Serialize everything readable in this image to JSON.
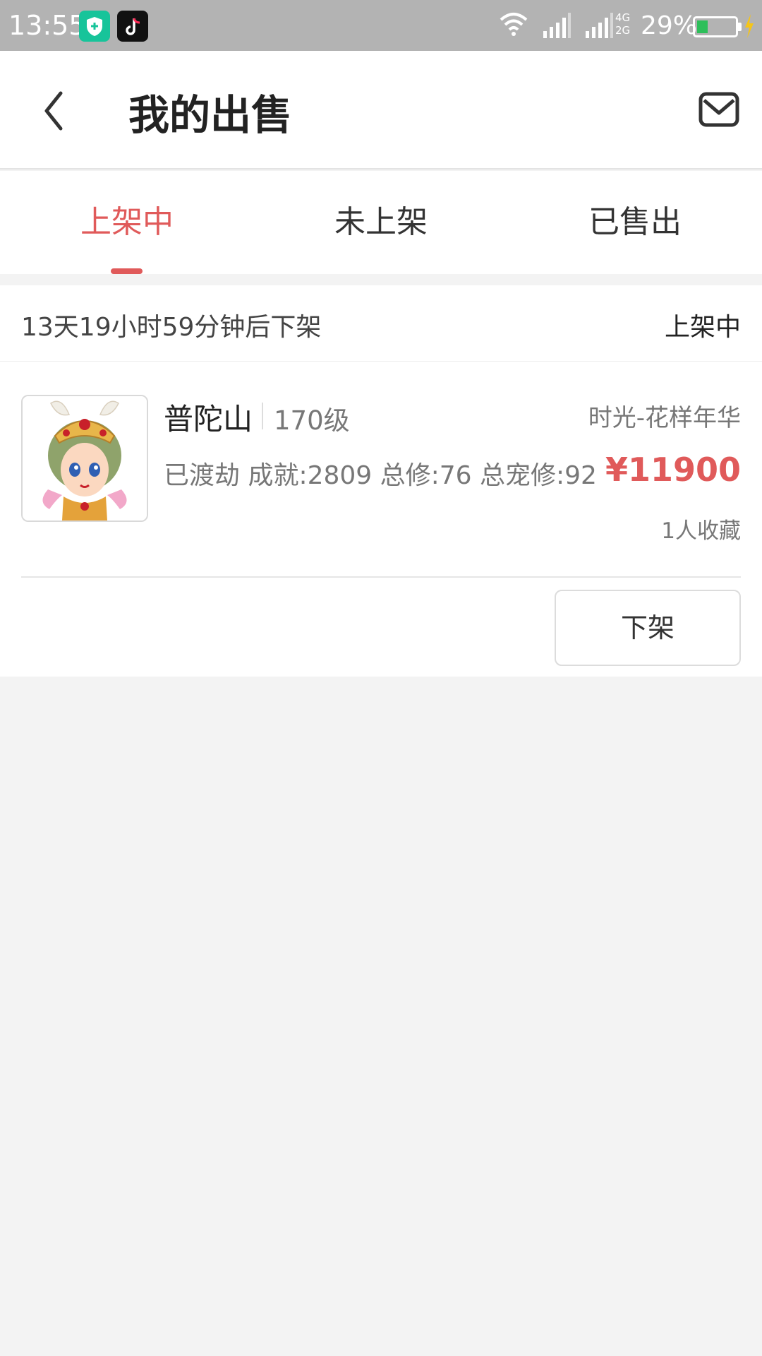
{
  "status_bar": {
    "time": "13:55",
    "network": "4G\n2G",
    "battery": "29%",
    "battery_level": 0.29,
    "icons": [
      "shield-app-icon",
      "tiktok-app-icon",
      "wifi-icon",
      "signal-icon",
      "signal-icon",
      "battery-icon",
      "charging-icon"
    ]
  },
  "header": {
    "back_icon": "chevron-left-icon",
    "title": "我的出售",
    "mail_icon": "mail-icon"
  },
  "tabs": [
    {
      "label": "上架中",
      "active": true
    },
    {
      "label": "未上架",
      "active": false
    },
    {
      "label": "已售出",
      "active": false
    }
  ],
  "listing": {
    "countdown": "13天19小时59分钟后下架",
    "status": "上架中",
    "name": "普陀山",
    "level": "170级",
    "server": "时光-花样年华",
    "stats": "已渡劫 成就:2809 总修:76 总宠修:92",
    "price": "¥11900",
    "favorites": "1人收藏",
    "delist_label": "下架"
  },
  "colors": {
    "accent": "#e05a5a",
    "status_bar": "#b3b3b3",
    "background": "#f3f3f3"
  }
}
